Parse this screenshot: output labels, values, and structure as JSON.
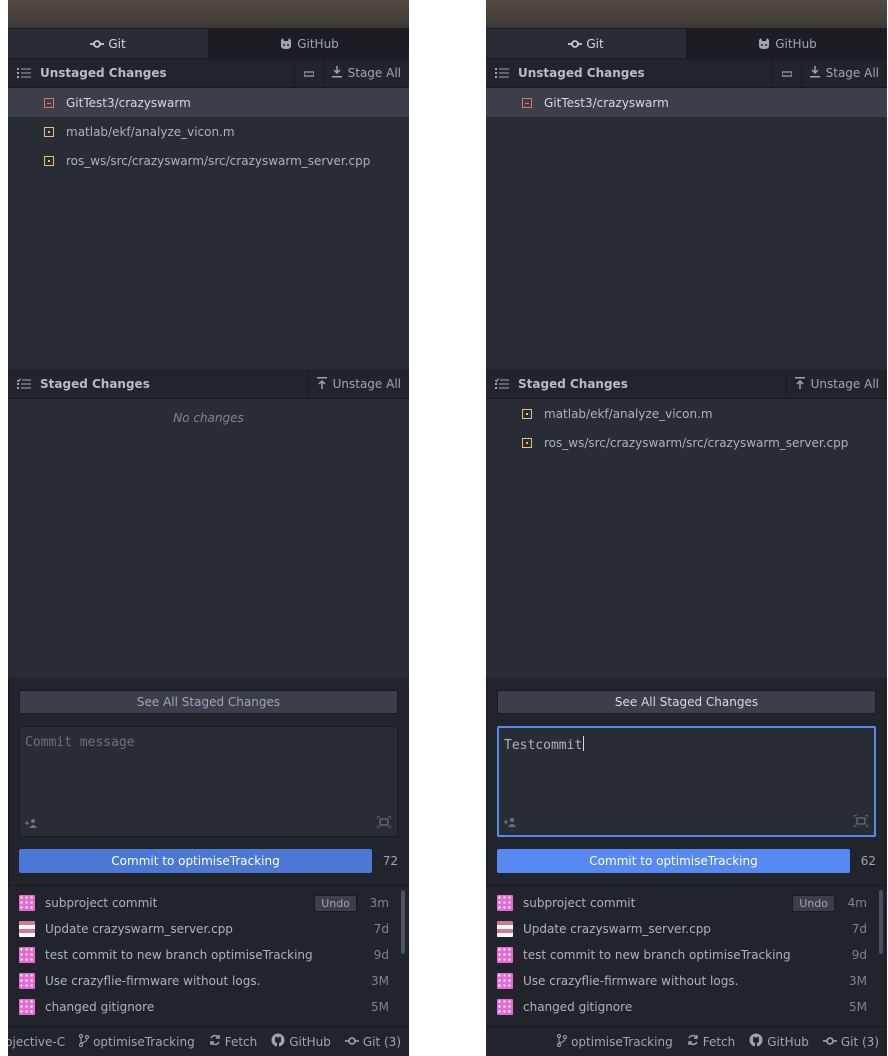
{
  "tabs": {
    "git": "Git",
    "github": "GitHub"
  },
  "sections": {
    "unstaged_title": "Unstaged Changes",
    "stage_all": "Stage All",
    "staged_title": "Staged Changes",
    "unstage_all": "Unstage All",
    "no_changes": "No changes"
  },
  "left": {
    "unstaged": [
      {
        "path": "GitTest3/crazyswarm",
        "status": "removed"
      },
      {
        "path": "matlab/ekf/analyze_vicon.m",
        "status": "modified"
      },
      {
        "path": "ros_ws/src/crazyswarm/src/crazyswarm_server.cpp",
        "status": "modified"
      }
    ],
    "see_all": "See All Staged Changes",
    "commit_placeholder": "Commit message",
    "commit_button": "Commit to optimiseTracking",
    "char_count": "72",
    "recent": [
      {
        "msg": "subproject commit",
        "age": "3m",
        "undo": "Undo"
      },
      {
        "msg": "Update crazyswarm_server.cpp",
        "age": "7d"
      },
      {
        "msg": "test commit to new branch optimiseTracking",
        "age": "9d"
      },
      {
        "msg": "Use crazyflie-firmware without logs.",
        "age": "3M"
      },
      {
        "msg": "changed gitignore",
        "age": "5M"
      }
    ],
    "statusbar": {
      "grammar": "Objective-C",
      "branch": "optimiseTracking",
      "fetch": "Fetch",
      "github": "GitHub",
      "git": "Git (3)"
    }
  },
  "right": {
    "unstaged": [
      {
        "path": "GitTest3/crazyswarm",
        "status": "removed"
      }
    ],
    "staged": [
      {
        "path": "matlab/ekf/analyze_vicon.m",
        "status": "modified"
      },
      {
        "path": "ros_ws/src/crazyswarm/src/crazyswarm_server.cpp",
        "status": "modified"
      }
    ],
    "see_all": "See All Staged Changes",
    "commit_value": "Testcommit",
    "commit_button": "Commit to optimiseTracking",
    "char_count": "62",
    "recent": [
      {
        "msg": "subproject commit",
        "age": "4m",
        "undo": "Undo"
      },
      {
        "msg": "Update crazyswarm_server.cpp",
        "age": "7d"
      },
      {
        "msg": "test commit to new branch optimiseTracking",
        "age": "9d"
      },
      {
        "msg": "Use crazyflie-firmware without logs.",
        "age": "3M"
      },
      {
        "msg": "changed gitignore",
        "age": "5M"
      }
    ],
    "statusbar": {
      "branch": "optimiseTracking",
      "fetch": "Fetch",
      "github": "GitHub",
      "git": "Git (3)"
    }
  },
  "colors": {
    "panel_bg": "#21252b",
    "list_bg": "#282c34",
    "selected_row": "#3a3f4b",
    "accent": "#4a78d4",
    "focus_border": "#568af2",
    "removed": "#e06c75",
    "modified": "#e5c07b"
  },
  "icons": [
    "git-commit-icon",
    "octocat-icon",
    "list-unordered-icon",
    "list-checked-icon",
    "dash-icon",
    "download-icon",
    "upload-icon",
    "person-add-icon",
    "screen-full-icon",
    "git-branch-icon",
    "sync-icon",
    "mark-github-icon"
  ]
}
